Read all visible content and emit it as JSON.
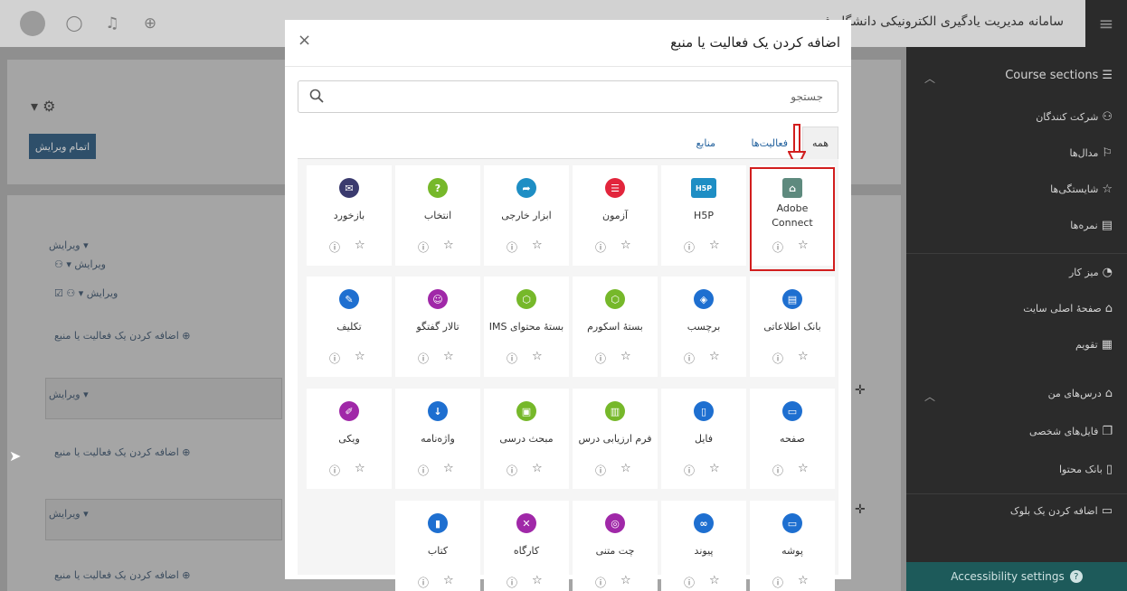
{
  "topbar": {
    "site_title": "سامانه مدیریت یادگیری الکترونیکی دانشگاه ف",
    "icons": [
      "avatar",
      "chat-icon",
      "bell-icon",
      "globe-icon"
    ],
    "menu_icon": "hamburger-icon"
  },
  "background": {
    "finish_edit_label": "اتمام ویرایش",
    "edit_label": "ویرایش",
    "add_activity_label": "اضافه کردن یک فعالیت یا منبع"
  },
  "sidebar": {
    "items": [
      {
        "label": "Course sections",
        "icon": "list-icon"
      },
      {
        "label": "شرکت کنندگان",
        "icon": "users-icon"
      },
      {
        "label": "مدال‌ها",
        "icon": "medal-icon"
      },
      {
        "label": "شایستگی‌ها",
        "icon": "star-icon"
      },
      {
        "label": "نمره‌ها",
        "icon": "grades-icon"
      },
      {
        "label": "میز کار",
        "icon": "dashboard-icon"
      },
      {
        "label": "صفحهٔ اصلی سایت",
        "icon": "home-icon"
      },
      {
        "label": "تقویم",
        "icon": "calendar-icon"
      },
      {
        "label": "درس‌های من",
        "icon": "graduation-icon"
      },
      {
        "label": "فایل‌های شخصی",
        "icon": "files-icon"
      },
      {
        "label": "بانک محتوا",
        "icon": "clipboard-icon"
      },
      {
        "label": "اضافه کردن یک بلوک",
        "icon": "folder-icon"
      }
    ],
    "accessibility_label": "Accessibility settings"
  },
  "modal": {
    "title": "اضافه کردن یک فعالیت یا منبع",
    "close_symbol": "×",
    "search_placeholder": "جستجو",
    "tabs": {
      "all": "همه",
      "activities": "فعالیت‌ها",
      "resources": "منابع"
    },
    "highlight_color": "#d21e1e",
    "tiles": [
      {
        "name": "Adobe Connect",
        "icon": "adobe-connect-icon",
        "color": "#5e8a7e",
        "glyph": "⌂",
        "highlighted": true
      },
      {
        "name": "H5P",
        "icon": "h5p-icon",
        "color": "#1e8ec4",
        "glyph": "H5P"
      },
      {
        "name": "آزمون",
        "icon": "quiz-icon",
        "color": "#e2253c",
        "glyph": "☰"
      },
      {
        "name": "ابزار خارجی",
        "icon": "external-tool-icon",
        "color": "#1e8ec4",
        "glyph": "➦"
      },
      {
        "name": "انتخاب",
        "icon": "choice-icon",
        "color": "#76b82a",
        "glyph": "?"
      },
      {
        "name": "بازخورد",
        "icon": "feedback-icon",
        "color": "#3a3a6e",
        "glyph": "✉"
      },
      {
        "name": "بانک اطلاعاتی",
        "icon": "database-icon",
        "color": "#1e6fd0",
        "glyph": "▤"
      },
      {
        "name": "برچسب",
        "icon": "label-icon",
        "color": "#1e6fd0",
        "glyph": "◈"
      },
      {
        "name": "بستهٔ اسکورم",
        "icon": "scorm-icon",
        "color": "#76b82a",
        "glyph": "⬡"
      },
      {
        "name": "بستهٔ محتوای IMS",
        "icon": "ims-icon",
        "color": "#76b82a",
        "glyph": "⬡"
      },
      {
        "name": "تالار گفتگو",
        "icon": "forum-icon",
        "color": "#a028a8",
        "glyph": "☺"
      },
      {
        "name": "تکلیف",
        "icon": "assignment-icon",
        "color": "#1e6fd0",
        "glyph": "✎"
      },
      {
        "name": "صفحه",
        "icon": "page-icon",
        "color": "#1e6fd0",
        "glyph": "▭"
      },
      {
        "name": "فایل",
        "icon": "file-icon",
        "color": "#1e6fd0",
        "glyph": "▯"
      },
      {
        "name": "فرم ارزیابی درس",
        "icon": "survey-icon",
        "color": "#76b82a",
        "glyph": "▥"
      },
      {
        "name": "مبحث درسی",
        "icon": "lesson-icon",
        "color": "#76b82a",
        "glyph": "▣"
      },
      {
        "name": "واژه‌نامه",
        "icon": "glossary-icon",
        "color": "#1e6fd0",
        "glyph": "↓"
      },
      {
        "name": "ویکی",
        "icon": "wiki-icon",
        "color": "#a028a8",
        "glyph": "✐"
      },
      {
        "name": "پوشه",
        "icon": "folder-icon",
        "color": "#1e6fd0",
        "glyph": "▭"
      },
      {
        "name": "پیوند",
        "icon": "link-icon",
        "color": "#1e6fd0",
        "glyph": "∞"
      },
      {
        "name": "چت متنی",
        "icon": "chat-icon",
        "color": "#a028a8",
        "glyph": "◎"
      },
      {
        "name": "کارگاه",
        "icon": "workshop-icon",
        "color": "#a028a8",
        "glyph": "✕"
      },
      {
        "name": "کتاب",
        "icon": "book-icon",
        "color": "#1e6fd0",
        "glyph": "▮"
      }
    ]
  }
}
